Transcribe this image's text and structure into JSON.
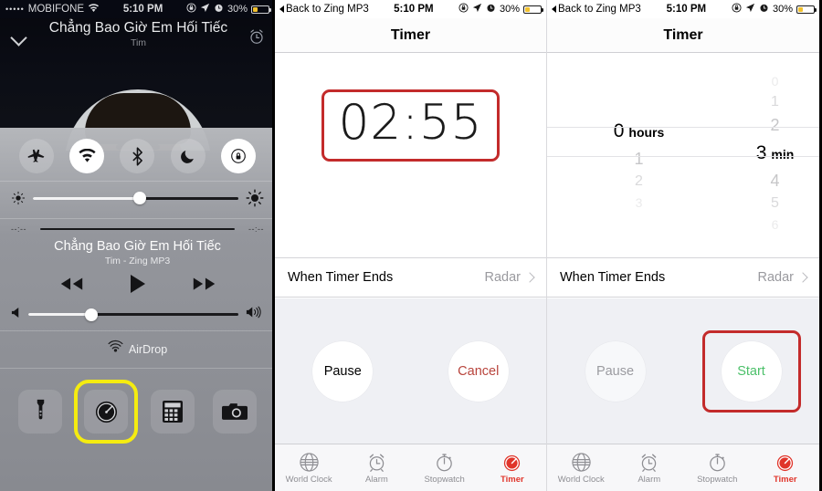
{
  "lockscreen": {
    "statusbar": {
      "signal_dots": "•••••",
      "carrier": "MOBIFONE",
      "wifi_icon": "wifi-icon",
      "time": "5:10 PM",
      "rotation_lock_icon": "rotation-lock-icon",
      "location_icon": "location-arrow-icon",
      "alarm_icon": "alarm-icon",
      "battery_percent": "30%"
    },
    "now_playing": {
      "collapse_icon": "chevron-down-icon",
      "title": "Chẳng Bao Giờ Em Hối Tiếc",
      "artist": "Tim",
      "alarm_icon": "alarm-clock-icon"
    },
    "control_center": {
      "toggles": [
        {
          "name": "airplane-mode",
          "icon": "airplane-icon",
          "on": false
        },
        {
          "name": "wifi",
          "icon": "wifi-icon",
          "on": true
        },
        {
          "name": "bluetooth",
          "icon": "bluetooth-icon",
          "on": false
        },
        {
          "name": "do-not-disturb",
          "icon": "moon-icon",
          "on": false
        },
        {
          "name": "rotation-lock",
          "icon": "rotation-lock-icon",
          "on": true
        }
      ],
      "brightness": {
        "low_icon": "sun-small-icon",
        "high_icon": "sun-large-icon",
        "value_percent": 52
      },
      "player": {
        "elapsed": "--:--",
        "remaining": "--:--",
        "title": "Chẳng Bao Giờ Em Hối Tiếc",
        "subtitle": "Tim - Zing MP3",
        "prev_icon": "rewind-icon",
        "play_icon": "play-icon",
        "next_icon": "fast-forward-icon",
        "volume": {
          "low_icon": "volume-min-icon",
          "high_icon": "volume-max-icon",
          "value_percent": 30
        }
      },
      "airdrop": {
        "icon": "airdrop-icon",
        "label": "AirDrop"
      },
      "shortcuts": [
        {
          "name": "flashlight",
          "icon": "flashlight-icon",
          "highlighted": false
        },
        {
          "name": "timer",
          "icon": "timer-icon",
          "highlighted": true
        },
        {
          "name": "calculator",
          "icon": "calculator-icon",
          "highlighted": false
        },
        {
          "name": "camera",
          "icon": "camera-icon",
          "highlighted": false
        }
      ],
      "highlight_color": "#f5ec10"
    }
  },
  "timer_running": {
    "statusbar": {
      "back_label": "Back to Zing MP3",
      "time": "5:10 PM",
      "battery_percent": "30%"
    },
    "navbar": {
      "title": "Timer"
    },
    "countdown": "02:55",
    "countdown_highlight_color": "#c32b2b",
    "when_timer_ends": {
      "label": "When Timer Ends",
      "value": "Radar",
      "chevron": "chevron-right-icon"
    },
    "buttons": [
      {
        "label": "Pause",
        "style": "normal"
      },
      {
        "label": "Cancel",
        "style": "cancel"
      }
    ],
    "tabs": [
      {
        "label": "World Clock",
        "icon": "globe-icon",
        "active": false
      },
      {
        "label": "Alarm",
        "icon": "alarm-clock-icon",
        "active": false
      },
      {
        "label": "Stopwatch",
        "icon": "stopwatch-icon",
        "active": false
      },
      {
        "label": "Timer",
        "icon": "timer-icon",
        "active": true
      }
    ]
  },
  "timer_setup": {
    "statusbar": {
      "back_label": "Back to Zing MP3",
      "time": "5:10 PM",
      "battery_percent": "30%"
    },
    "navbar": {
      "title": "Timer"
    },
    "picker": {
      "hours": {
        "above": [
          "",
          "",
          ""
        ],
        "selected": "0",
        "unit": "hours",
        "below": [
          "1",
          "2",
          "3"
        ]
      },
      "minutes": {
        "above": [
          "0",
          "1",
          "2"
        ],
        "selected": "3",
        "unit": "min",
        "below": [
          "4",
          "5",
          "6"
        ]
      }
    },
    "when_timer_ends": {
      "label": "When Timer Ends",
      "value": "Radar",
      "chevron": "chevron-right-icon"
    },
    "buttons": [
      {
        "label": "Pause",
        "style": "disabled"
      },
      {
        "label": "Start",
        "style": "start"
      }
    ],
    "start_highlight_color": "#c32b2b",
    "tabs": [
      {
        "label": "World Clock",
        "icon": "globe-icon",
        "active": false
      },
      {
        "label": "Alarm",
        "icon": "alarm-clock-icon",
        "active": false
      },
      {
        "label": "Stopwatch",
        "icon": "stopwatch-icon",
        "active": false
      },
      {
        "label": "Timer",
        "icon": "timer-icon",
        "active": true
      }
    ]
  }
}
